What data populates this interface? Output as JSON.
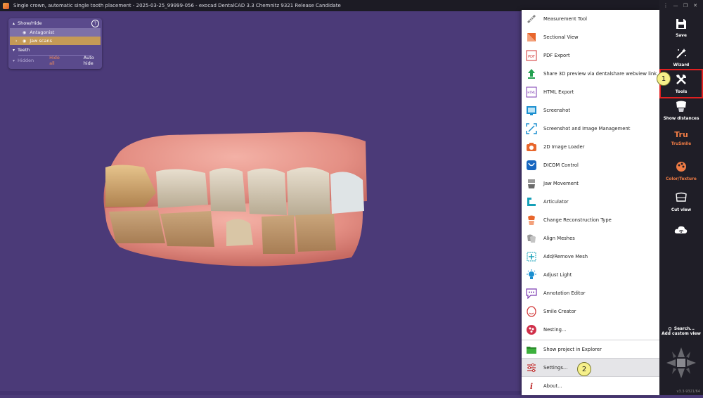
{
  "window": {
    "title": "Single crown, automatic single tooth placement - 2025-03-25_99999-056 - exocad DentalCAD 3.3 Chemnitz 9321 Release Candidate",
    "controls": [
      "⋮",
      "—",
      "❐",
      "✕"
    ]
  },
  "show_hide_panel": {
    "header": "Show/Hide",
    "help": "?",
    "rows": [
      {
        "label": "Antagonist"
      },
      {
        "label": "Jaw scans"
      }
    ],
    "teeth_label": "Teeth",
    "hidden_label": "Hidden",
    "hide_all_label": "Hide all",
    "auto_hide_label": "Auto hide"
  },
  "tools_menu": {
    "items": [
      {
        "label": "Measurement Tool"
      },
      {
        "label": "Sectional View"
      },
      {
        "label": "PDF Export"
      },
      {
        "label": "Share 3D preview via dentalshare webview link"
      },
      {
        "label": "HTML Export"
      },
      {
        "label": "Screenshot"
      },
      {
        "label": "Screenshot and Image Management"
      },
      {
        "label": "2D Image Loader"
      },
      {
        "label": "DICOM Control"
      },
      {
        "label": "Jaw Movement"
      },
      {
        "label": "Articulator"
      },
      {
        "label": "Change Reconstruction Type"
      },
      {
        "label": "Align Meshes"
      },
      {
        "label": "Add/Remove Mesh"
      },
      {
        "label": "Adjust Light"
      },
      {
        "label": "Annotation Editor"
      },
      {
        "label": "Smile Creator"
      },
      {
        "label": "Nesting..."
      },
      {
        "label": "Show project in Explorer"
      },
      {
        "label": "Settings..."
      },
      {
        "label": "About..."
      }
    ]
  },
  "right_toolbar": {
    "buttons": [
      {
        "label": "Save",
        "icon": "save-icon"
      },
      {
        "label": "Wizard",
        "icon": "wizard-icon"
      },
      {
        "label": "Tools",
        "icon": "tools-icon"
      },
      {
        "label": "Show distances",
        "icon": "show-distances-icon"
      },
      {
        "label": "TruSmile",
        "icon": "trusmile-icon"
      },
      {
        "label": "Color/Texture",
        "icon": "color-texture-icon"
      },
      {
        "label": "Cut view",
        "icon": "cut-view-icon"
      },
      {
        "label": "",
        "icon": "cloud-wifi-icon"
      }
    ],
    "search_label": "Search...",
    "add_custom_view_label": "Add custom view",
    "version": "v3.3-9321/64"
  },
  "callouts": [
    "1",
    "2"
  ]
}
